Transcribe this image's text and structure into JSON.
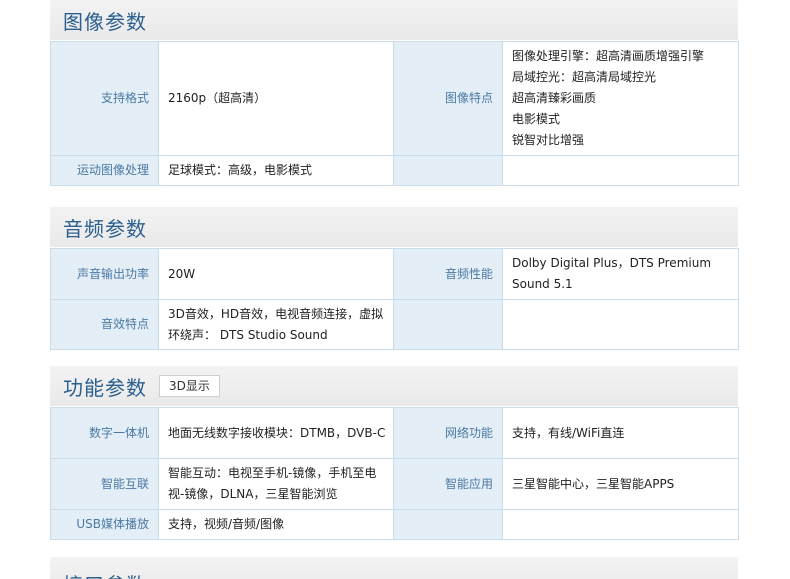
{
  "sections": [
    {
      "title": "图像参数",
      "rows": [
        {
          "l1": "支持格式",
          "v1": "2160p（超高清）",
          "l2": "图像特点",
          "v2": [
            "图像处理引擎：超高清画质增强引擎",
            "局域控光：超高清局域控光",
            "超高清臻彩画质",
            "电影模式",
            "锐智对比增强"
          ]
        },
        {
          "l1": "运动图像处理",
          "v1": "足球模式：高级，电影模式",
          "l2": "",
          "v2": ""
        }
      ]
    },
    {
      "title": "音频参数",
      "rows": [
        {
          "l1": "声音输出功率",
          "v1": "20W",
          "l2": "音频性能",
          "v2": "Dolby Digital Plus，DTS Premium Sound 5.1"
        },
        {
          "l1": "音效特点",
          "v1": "3D音效，HD音效，电视音频连接，虚拟环绕声： DTS Studio Sound",
          "l2": "",
          "v2": ""
        }
      ]
    },
    {
      "title": "功能参数",
      "tag": "3D显示",
      "rows": [
        {
          "l1": "数字一体机",
          "v1": "地面无线数字接收模块：DTMB，DVB-C",
          "l2": "网络功能",
          "v2": "支持，有线/WiFi直连"
        },
        {
          "l1": "智能互联",
          "v1": "智能互动：电视至手机-镜像，手机至电视-镜像，DLNA，三星智能浏览",
          "l2": "智能应用",
          "v2": "三星智能中心，三星智能APPS"
        },
        {
          "l1": "USB媒体播放",
          "v1": "支持，视频/音频/图像",
          "l2": "",
          "v2": ""
        }
      ]
    },
    {
      "title": "接口参数"
    }
  ]
}
